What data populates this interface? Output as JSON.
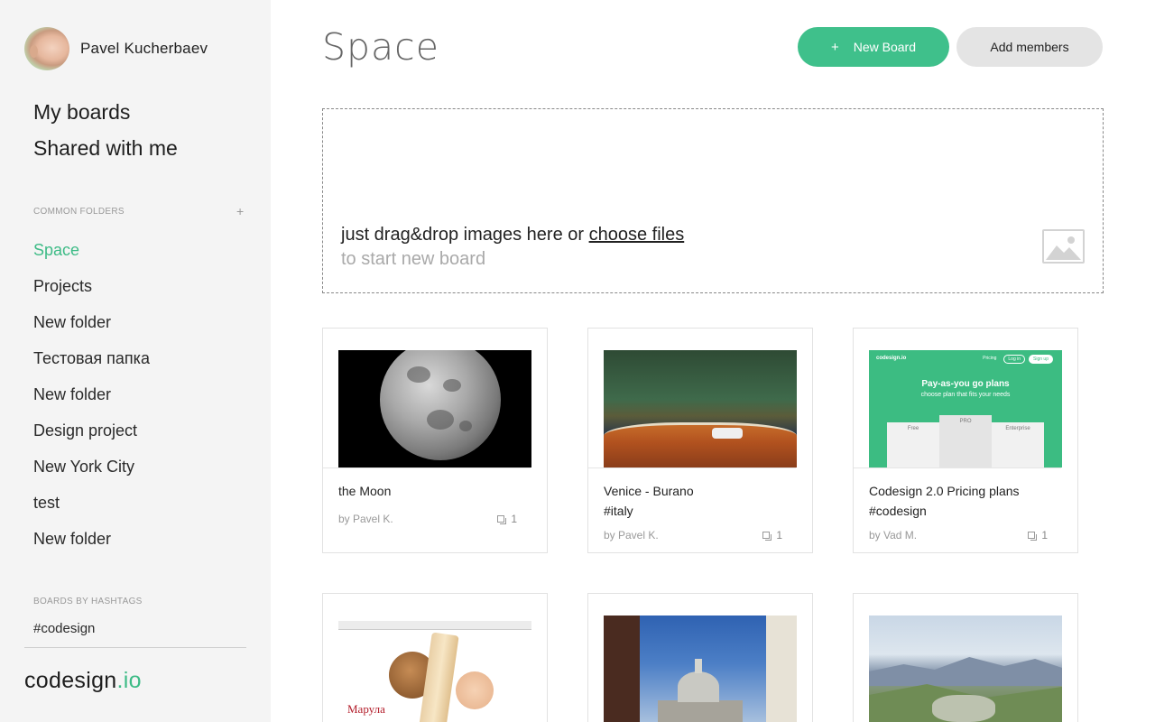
{
  "user": {
    "name": "Pavel Kucherbaev"
  },
  "nav": {
    "my_boards": "My boards",
    "shared": "Shared with me"
  },
  "folders": {
    "label": "COMMON FOLDERS",
    "add": "+",
    "items": [
      "Space",
      "Projects",
      "New folder",
      "Тестовая папка",
      "New folder",
      "Design project",
      "New York City",
      "test",
      "New folder"
    ],
    "active_index": 0
  },
  "hashtags": {
    "label": "BOARDS BY HASHTAGS",
    "items": [
      "#codesign"
    ]
  },
  "logo": {
    "main": "codesign",
    "accent": ".io"
  },
  "page": {
    "title": "Space"
  },
  "buttons": {
    "new_board_icon": "+",
    "new_board": "New Board",
    "add_members": "Add members"
  },
  "dropzone": {
    "text": "just drag&drop images here or ",
    "link": "choose files",
    "sub": "to start new board"
  },
  "boards": [
    {
      "title": "the Moon",
      "hashtag": "",
      "author": "by Pavel K.",
      "count": "1",
      "thumb": "moon"
    },
    {
      "title": "Venice - Burano",
      "hashtag": "#italy",
      "author": "by Pavel K.",
      "count": "1",
      "thumb": "venice"
    },
    {
      "title": "Codesign 2.0 Pricing plans",
      "hashtag": "#codesign",
      "author": "by Vad M.",
      "count": "1",
      "thumb": "pricing"
    },
    {
      "title": "",
      "hashtag": "",
      "author": "",
      "count": "",
      "thumb": "cosmetics"
    },
    {
      "title": "",
      "hashtag": "",
      "author": "",
      "count": "",
      "thumb": "london"
    },
    {
      "title": "",
      "hashtag": "",
      "author": "",
      "count": "",
      "thumb": "mountains"
    }
  ],
  "pricing_thumb": {
    "logo": "codesign.io",
    "nav": [
      "Pricing",
      "Log in",
      "Sign up"
    ],
    "heading": "Pay-as-you go plans",
    "sub": "choose plan that fits your needs",
    "tiers": [
      "Free",
      "PRO",
      "Enterprise"
    ]
  },
  "cosmetics_thumb": {
    "brand": "Марула"
  },
  "colors": {
    "accent": "#3dbb86",
    "sidebar_bg": "#f4f4f4",
    "button_gray": "#e4e4e4"
  }
}
